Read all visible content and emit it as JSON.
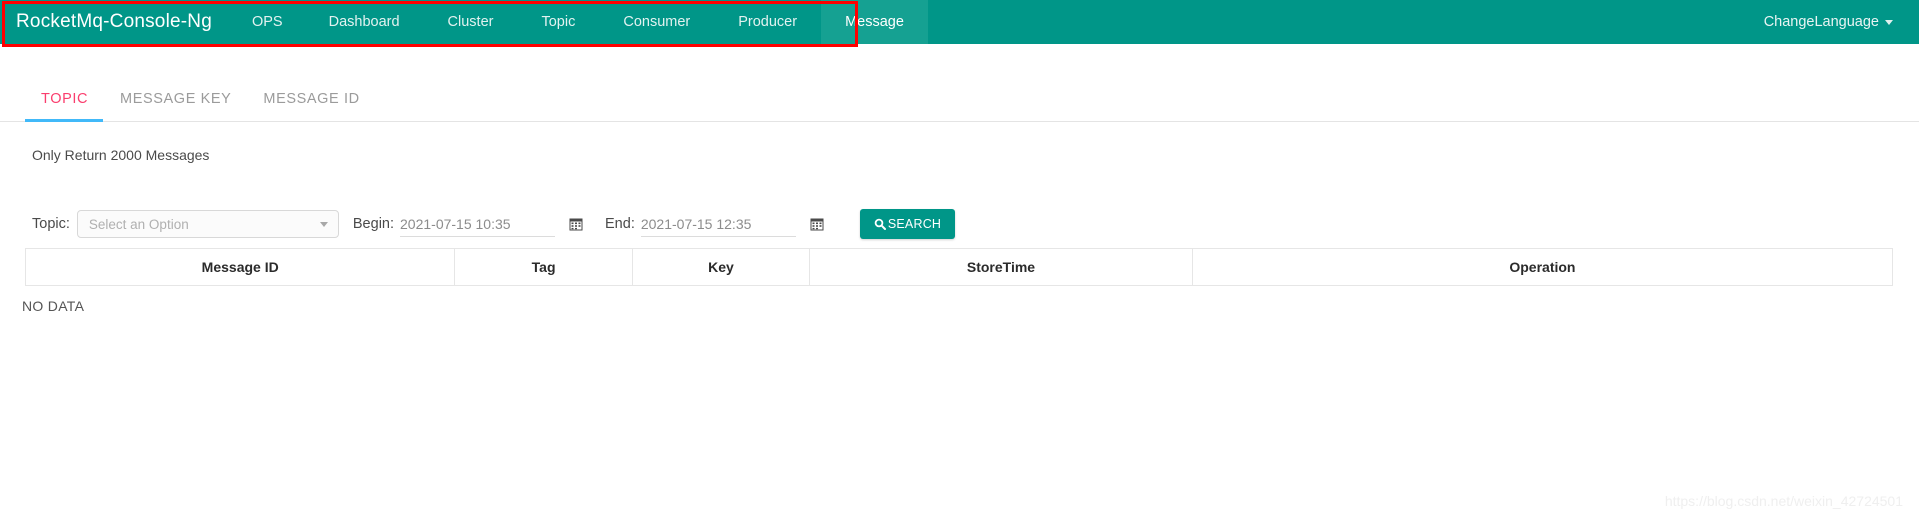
{
  "navbar": {
    "brand": "RocketMq-Console-Ng",
    "items": [
      {
        "label": "OPS",
        "active": false
      },
      {
        "label": "Dashboard",
        "active": false
      },
      {
        "label": "Cluster",
        "active": false
      },
      {
        "label": "Topic",
        "active": false
      },
      {
        "label": "Consumer",
        "active": false
      },
      {
        "label": "Producer",
        "active": false
      },
      {
        "label": "Message",
        "active": true
      }
    ],
    "language_label": "ChangeLanguage",
    "background_color": "#009688",
    "active_item_color": "#15a192"
  },
  "annotation": {
    "color": "#fe0000"
  },
  "tabs": {
    "items": [
      {
        "label": "TOPIC",
        "active": true
      },
      {
        "label": "MESSAGE KEY",
        "active": false
      },
      {
        "label": "MESSAGE ID",
        "active": false
      }
    ],
    "active_text_color": "#fa3e6e",
    "underline_color": "#41b9f9"
  },
  "notice": {
    "text": "Only Return 2000 Messages"
  },
  "form": {
    "topic_label": "Topic:",
    "topic_placeholder": "Select an Option",
    "begin_label": "Begin:",
    "begin_value": "2021-07-15 10:35",
    "end_label": "End:",
    "end_value": "2021-07-15 12:35",
    "search_label": "SEARCH",
    "search_icon": "search-icon",
    "calendar_icon": "calendar-icon",
    "search_button_color": "#009688"
  },
  "table": {
    "columns": [
      "Message ID",
      "Tag",
      "Key",
      "StoreTime",
      "Operation"
    ],
    "rows": [],
    "empty_text": "NO DATA"
  },
  "watermark": {
    "text": "https://blog.csdn.net/weixin_42724501"
  }
}
